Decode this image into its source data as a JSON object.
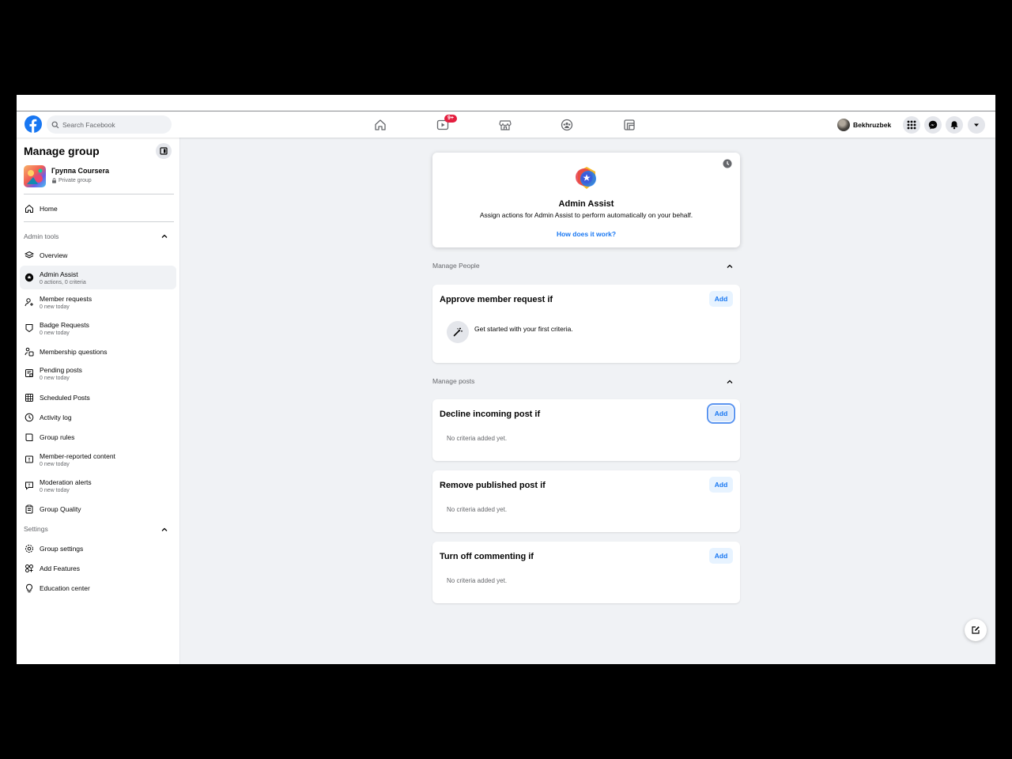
{
  "topbar": {
    "search_placeholder": "Search Facebook",
    "watch_badge": "9+",
    "profile_name": "Bekhruzbek"
  },
  "sidebar": {
    "title": "Manage group",
    "group_name": "Группа Coursera",
    "group_privacy": "Private group",
    "home_label": "Home",
    "admin_tools_label": "Admin tools",
    "admin_items": [
      {
        "label": "Overview",
        "sub": ""
      },
      {
        "label": "Admin Assist",
        "sub": "0 actions, 0 criteria"
      },
      {
        "label": "Member requests",
        "sub": "0 new today"
      },
      {
        "label": "Badge Requests",
        "sub": "0 new today"
      },
      {
        "label": "Membership questions",
        "sub": ""
      },
      {
        "label": "Pending posts",
        "sub": "0 new today"
      },
      {
        "label": "Scheduled Posts",
        "sub": ""
      },
      {
        "label": "Activity log",
        "sub": ""
      },
      {
        "label": "Group rules",
        "sub": ""
      },
      {
        "label": "Member-reported content",
        "sub": "0 new today"
      },
      {
        "label": "Moderation alerts",
        "sub": "0 new today"
      },
      {
        "label": "Group Quality",
        "sub": ""
      }
    ],
    "settings_label": "Settings",
    "settings_items": [
      {
        "label": "Group settings"
      },
      {
        "label": "Add Features"
      },
      {
        "label": "Education center"
      }
    ]
  },
  "main": {
    "hero": {
      "title": "Admin Assist",
      "description": "Assign actions for Admin Assist to perform automatically on your behalf.",
      "link": "How does it work?"
    },
    "manage_people_label": "Manage People",
    "approve": {
      "title": "Approve member request if",
      "add_label": "Add",
      "get_started": "Get started with your first criteria."
    },
    "manage_posts_label": "Manage posts",
    "decline": {
      "title": "Decline incoming post if",
      "add_label": "Add",
      "empty": "No criteria added yet."
    },
    "remove": {
      "title": "Remove published post if",
      "add_label": "Add",
      "empty": "No criteria added yet."
    },
    "commenting": {
      "title": "Turn off commenting if",
      "add_label": "Add",
      "empty": "No criteria added yet."
    }
  },
  "colors": {
    "brand": "#1877f2",
    "badge": "#e41e3f",
    "page_bg": "#f0f2f5"
  }
}
